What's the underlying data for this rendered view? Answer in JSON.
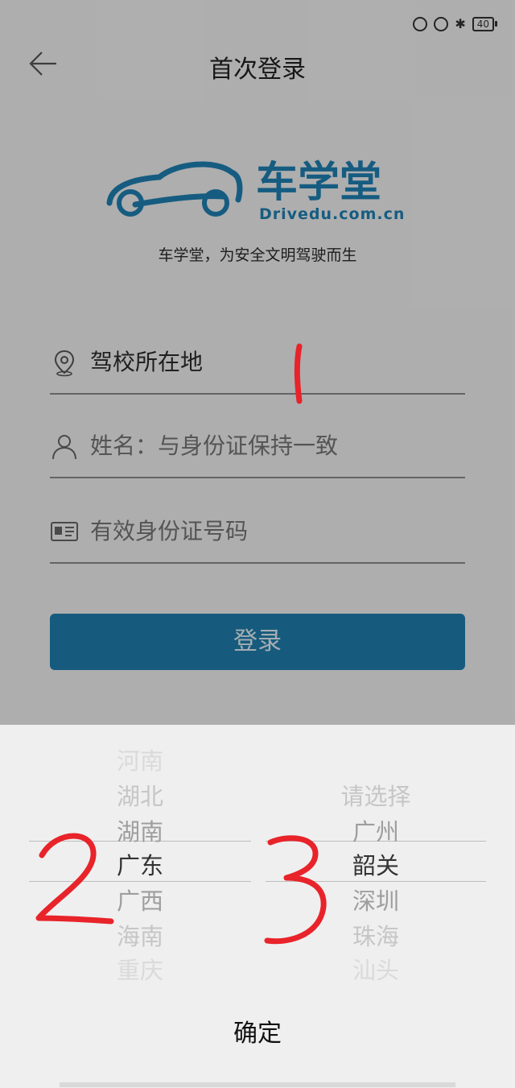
{
  "status_bar": {
    "battery": "40"
  },
  "header": {
    "title": "首次登录",
    "back_icon": "arrow-left-icon"
  },
  "logo": {
    "brand": "车学堂",
    "domain": "Drivedu.com.cn",
    "color": "#1f80b3"
  },
  "slogan": "车学堂，为安全文明驾驶而生",
  "form": {
    "location_label": "驾校所在地",
    "name_placeholder": "姓名：与身份证保持一致",
    "id_placeholder": "有效身份证号码"
  },
  "login_label": "登录",
  "picker": {
    "provinces": [
      "河南",
      "湖北",
      "湖南",
      "广东",
      "广西",
      "海南",
      "重庆"
    ],
    "cities": [
      "请选择",
      "广州",
      "韶关",
      "深圳",
      "珠海",
      "汕头"
    ],
    "confirm_label": "确定"
  },
  "annotations": [
    "1",
    "2",
    "3"
  ],
  "colors": {
    "accent": "#1f7fad",
    "annotation": "#e8232a"
  }
}
